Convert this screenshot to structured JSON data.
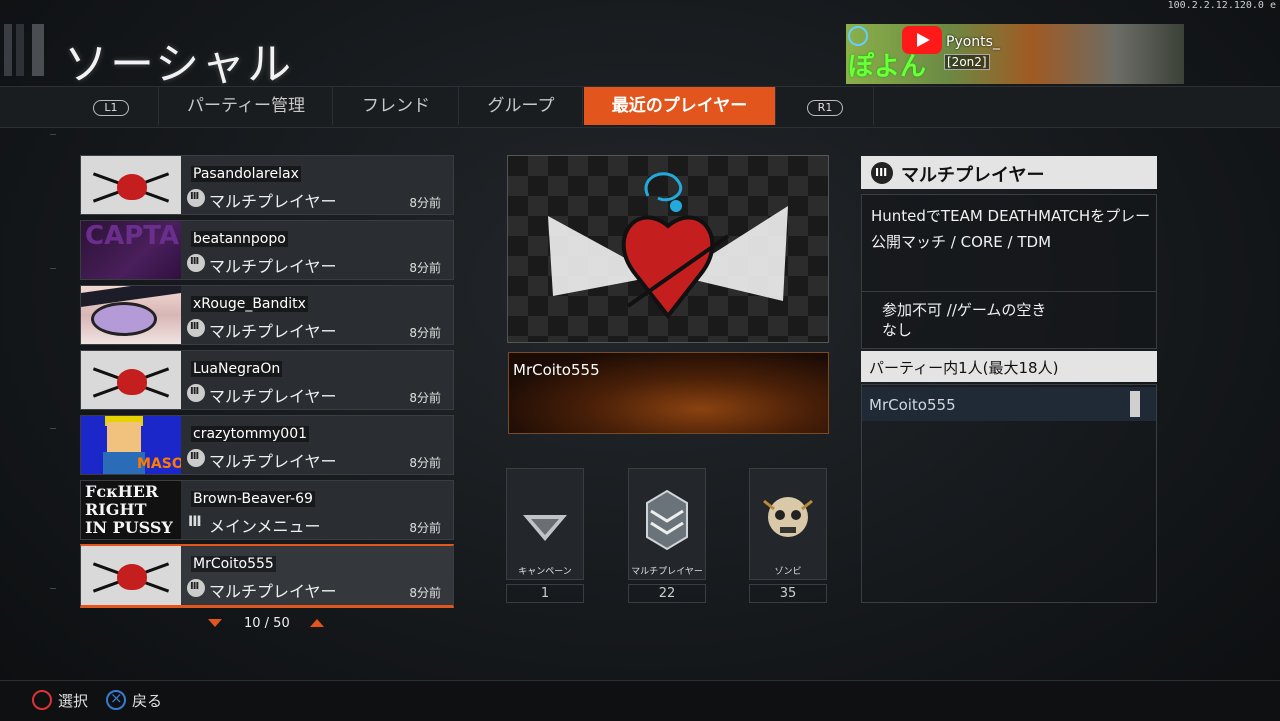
{
  "version": "100.2.2.12.120.0 e",
  "page_title": "ソーシャル",
  "streamer": {
    "logo_text": "ぽよん",
    "name": "Pyonts_",
    "tag": "[2on2]"
  },
  "tabs": {
    "l1": "L1",
    "items": [
      "パーティー管理",
      "フレンド",
      "グループ",
      "最近のプレイヤー"
    ],
    "active_index": 3,
    "r1": "R1"
  },
  "players": [
    {
      "name": "Pasandolarelax",
      "mode": "マルチプレイヤー",
      "time": "8分前",
      "emblem": "heart"
    },
    {
      "name": "beatannpopo",
      "mode": "マルチプレイヤー",
      "time": "8分前",
      "emblem": "purple",
      "emblem_text": "CAPTAIN"
    },
    {
      "name": "xRouge_Banditx",
      "mode": "マルチプレイヤー",
      "time": "8分前",
      "emblem": "anime"
    },
    {
      "name": "LuaNegraOn",
      "mode": "マルチプレイヤー",
      "time": "8分前",
      "emblem": "heart"
    },
    {
      "name": "crazytommy001",
      "mode": "マルチプレイヤー",
      "time": "8分前",
      "emblem": "pixel",
      "emblem_text": "MASO"
    },
    {
      "name": "Brown-Beaver-69",
      "mode": "メインメニュー",
      "time": "8分前",
      "emblem": "text",
      "emblem_text_lines": [
        "FᴄᴋHER RIGHT",
        "IN PUSSY"
      ]
    },
    {
      "name": "MrCoito555",
      "mode": "マルチプレイヤー",
      "time": "8分前",
      "emblem": "heart",
      "selected": true
    }
  ],
  "pager": {
    "current": 10,
    "total": 50,
    "text": "10 / 50"
  },
  "selected_player": {
    "name": "MrCoito555",
    "ranks": [
      {
        "label": "キャンペーン",
        "value": "1"
      },
      {
        "label": "マルチプレイヤー",
        "value": "22"
      },
      {
        "label": "ゾンビ",
        "value": "35"
      }
    ]
  },
  "info": {
    "header": "マルチプレイヤー",
    "line1": "HuntedでTEAM DEATHMATCHをプレー",
    "line2": "公開マッチ / CORE / TDM",
    "join_line1": "参加不可 //ゲームの空き",
    "join_line2": "なし"
  },
  "party": {
    "header": "パーティー内1人(最大18人)",
    "members": [
      "MrCoito555"
    ]
  },
  "footer": {
    "select": "選択",
    "back": "戻る"
  },
  "colors": {
    "accent": "#e2561e",
    "panel": "#2a2d31"
  }
}
